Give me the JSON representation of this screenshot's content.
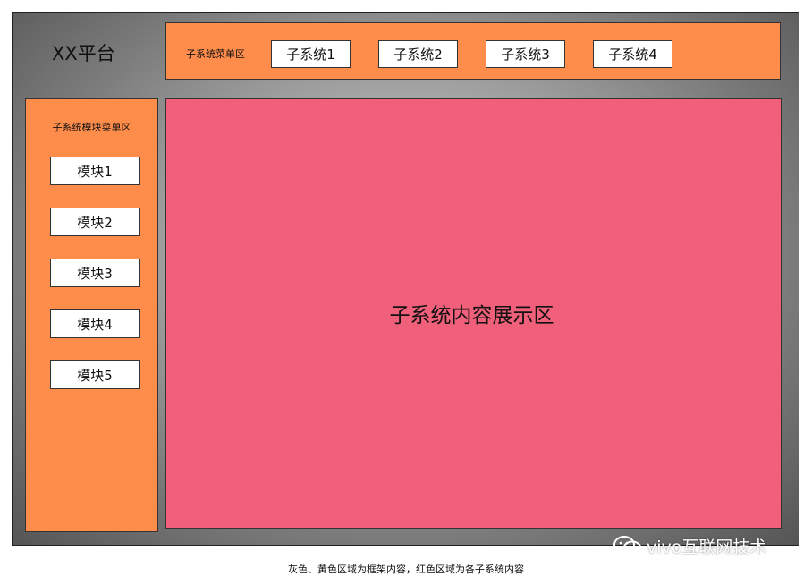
{
  "platform": {
    "title": "XX平台"
  },
  "topbar": {
    "label": "子系统菜单区",
    "buttons": [
      "子系统1",
      "子系统2",
      "子系统3",
      "子系统4"
    ]
  },
  "sidebar": {
    "label": "子系统模块菜单区",
    "buttons": [
      "模块1",
      "模块2",
      "模块3",
      "模块4",
      "模块5"
    ]
  },
  "content": {
    "label": "子系统内容展示区"
  },
  "watermark": {
    "text": "vivo互联网技术",
    "icon": "wechat-icon"
  },
  "caption": "灰色、黄色区域为框架内容，红色区域为各子系统内容",
  "colors": {
    "frame_gray": "#a9a9a9",
    "menu_orange": "#fe8c4a",
    "content_red": "#f0607a"
  }
}
